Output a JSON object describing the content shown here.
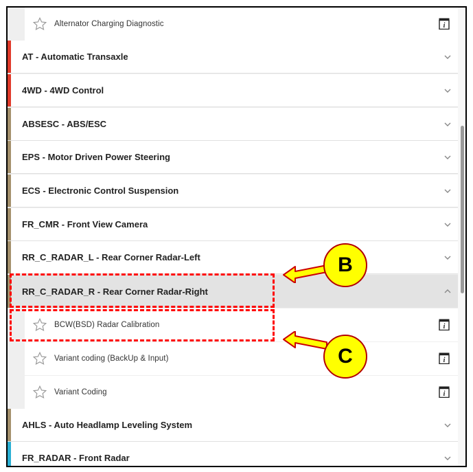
{
  "colors": {
    "bar_red": "#e03a2a",
    "bar_tan": "#a4906c",
    "bar_cyan": "#2ab0d4",
    "callout_yellow": "#ffff00",
    "highlight_red": "#ff0000"
  },
  "sub_items": [
    {
      "label": "Alternator Charging Diagnostic",
      "icon": "star-icon",
      "info_icon": "info-icon"
    },
    {
      "label": "BCW(BSD) Radar Calibration",
      "icon": "star-icon",
      "info_icon": "info-icon"
    },
    {
      "label": "Variant coding (BackUp & Input)",
      "icon": "star-icon",
      "info_icon": "info-icon"
    },
    {
      "label": "Variant Coding",
      "icon": "star-icon",
      "info_icon": "info-icon"
    }
  ],
  "sections": [
    {
      "title": "AT - Automatic Transaxle",
      "bar_color": "#e03a2a",
      "expanded": false
    },
    {
      "title": "4WD - 4WD Control",
      "bar_color": "#e03a2a",
      "expanded": false
    },
    {
      "title": "ABSESC - ABS/ESC",
      "bar_color": "#a4906c",
      "expanded": false
    },
    {
      "title": "EPS - Motor Driven Power Steering",
      "bar_color": "#a4906c",
      "expanded": false
    },
    {
      "title": "ECS - Electronic Control Suspension",
      "bar_color": "#a4906c",
      "expanded": false
    },
    {
      "title": "FR_CMR - Front View Camera",
      "bar_color": "#a4906c",
      "expanded": false
    },
    {
      "title": "RR_C_RADAR_L - Rear Corner Radar-Left",
      "bar_color": "#a4906c",
      "expanded": false
    },
    {
      "title": "RR_C_RADAR_R - Rear Corner Radar-Right",
      "bar_color": "#a4906c",
      "expanded": true
    },
    {
      "title": "AHLS - Auto Headlamp Leveling System",
      "bar_color": "#a4906c",
      "expanded": false
    },
    {
      "title": "FR_RADAR - Front Radar",
      "bar_color": "#2ab0d4",
      "expanded": false
    }
  ],
  "callouts": {
    "b_label": "B",
    "c_label": "C"
  }
}
